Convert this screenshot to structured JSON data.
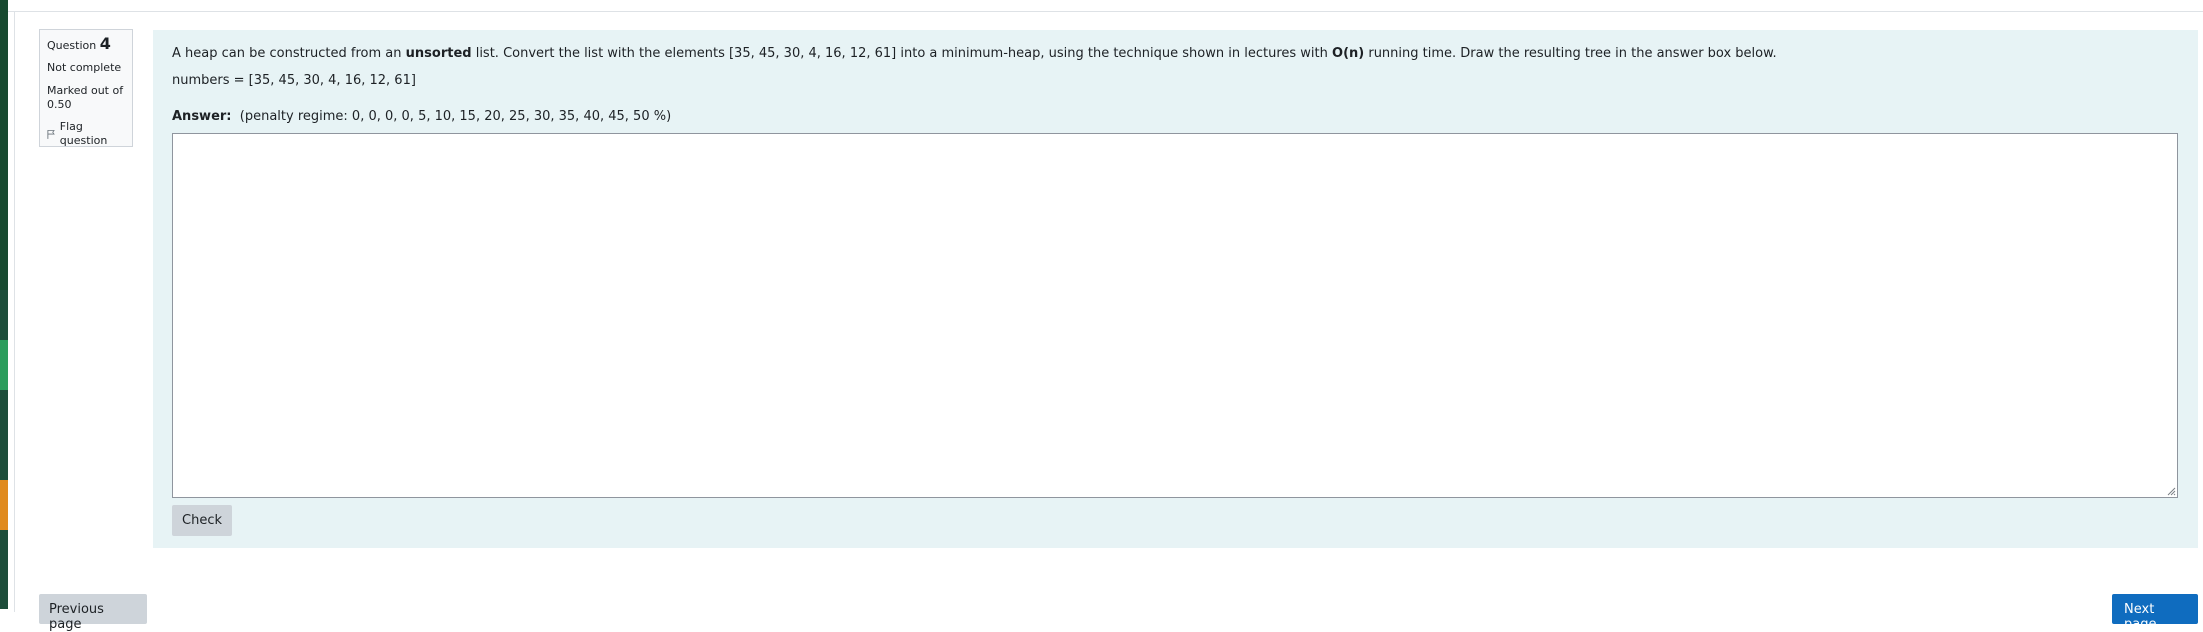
{
  "question_info": {
    "label": "Question",
    "number": "4",
    "state": "Not complete",
    "grade_label": "Marked out of",
    "grade_value": "0.50",
    "flag_label": "Flag question"
  },
  "question": {
    "text_part1": "A heap can be constructed from an ",
    "text_bold1": "unsorted",
    "text_part2": " list. Convert the list with the elements [35, 45, 30, 4, 16, 12, 61] into a minimum-heap, using the technique shown in lectures with ",
    "text_bold2": "O(n)",
    "text_part3": " running time. Draw the resulting tree in the answer box below.",
    "numbers_line": "numbers = [35, 45, 30, 4, 16, 12, 61]",
    "answer_label": "Answer:",
    "penalty_text": "(penalty regime: 0, 0, 0, 0, 5, 10, 15, 20, 25, 30, 35, 40, 45, 50 %)",
    "answer_value": ""
  },
  "buttons": {
    "check": "Check",
    "previous": "Previous page",
    "next": "Next page"
  },
  "colors": {
    "content_bg": "#e7f3f5",
    "next_button": "#0f6cbf",
    "secondary_button": "#ced4da"
  },
  "icons": {
    "flag": "flag-icon",
    "resize": "resize-grip-icon"
  }
}
